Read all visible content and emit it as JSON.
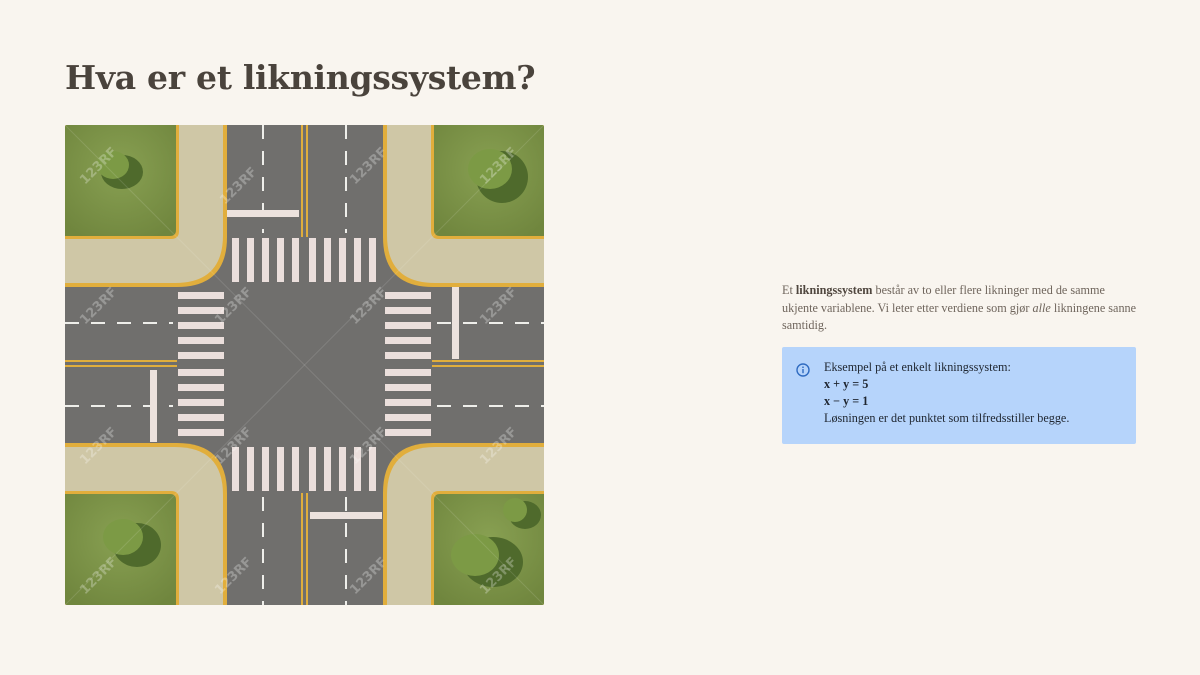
{
  "page": {
    "title": "Hva er et likningssystem?"
  },
  "illustration": {
    "subject": "road-intersection-top-view",
    "watermark_text": "123RF"
  },
  "intro": {
    "lead": "Et ",
    "term": "likningssystem",
    "middle": " består av to eller flere likninger med de samme ukjente variablene. Vi leter etter verdiene som gjør ",
    "emphasis": "alle",
    "tail": " likningene sanne samtidig."
  },
  "callout": {
    "icon": "info-icon",
    "heading": "Eksempel på et enkelt likningssystem:",
    "equation_1": "x + y = 5",
    "equation_2": "x − y = 1",
    "conclusion": "Løsningen er det punktet som tilfredsstiller begge."
  },
  "colors": {
    "background": "#f9f5ef",
    "title": "#4a433c",
    "callout_bg": "#b6d4fb",
    "info_icon": "#2f6bc1",
    "asphalt": "#6f6e6c",
    "grass": "#7c9248",
    "sidewalk": "#cfc7a6",
    "curb": "#e0ad3a"
  }
}
